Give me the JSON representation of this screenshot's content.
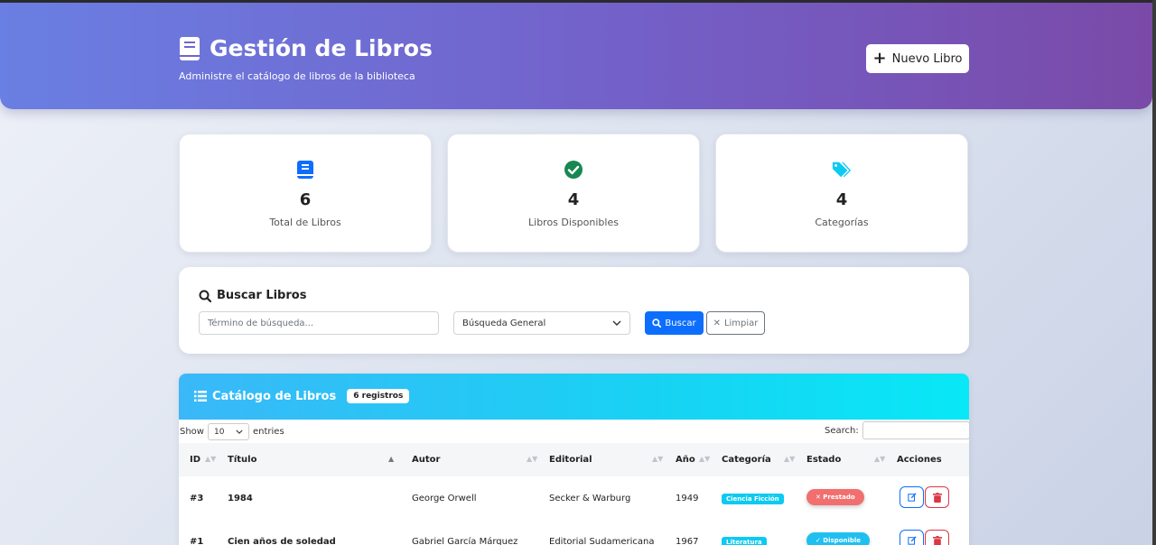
{
  "header": {
    "title": "Gestión de Libros",
    "subtitle": "Administre el catálogo de libros de la biblioteca",
    "new_button": "Nuevo Libro"
  },
  "stats": [
    {
      "icon": "book-icon",
      "value": "6",
      "label": "Total de Libros",
      "color": "#0d6efd"
    },
    {
      "icon": "check-circle-icon",
      "value": "4",
      "label": "Libros Disponibles",
      "color": "#198754"
    },
    {
      "icon": "tags-icon",
      "value": "4",
      "label": "Categorías",
      "color": "#0dcaf0"
    }
  ],
  "search": {
    "title": "Buscar Libros",
    "placeholder": "Término de búsqueda...",
    "select_value": "Búsqueda General",
    "search_button": "Buscar",
    "clear_button": "Limpiar"
  },
  "table": {
    "title": "Catálogo de Libros",
    "badge": "6 registros",
    "show_label": "Show",
    "length_value": "10",
    "entries_label": "entries",
    "search_label": "Search:",
    "columns": [
      "ID",
      "Título",
      "Autor",
      "Editorial",
      "Año",
      "Categoría",
      "Estado",
      "Acciones"
    ],
    "rows": [
      {
        "id": "#3",
        "titulo": "1984",
        "autor": "George Orwell",
        "editorial": "Secker & Warburg",
        "anio": "1949",
        "categoria": "Ciencia Ficción",
        "estado": "✕ Prestado"
      },
      {
        "id": "#1",
        "titulo": "Cien años de soledad",
        "autor": "Gabriel García Márquez",
        "editorial": "Editorial Sudamericana",
        "anio": "1967",
        "categoria": "Literatura",
        "estado": "✓ Disponible"
      }
    ]
  }
}
